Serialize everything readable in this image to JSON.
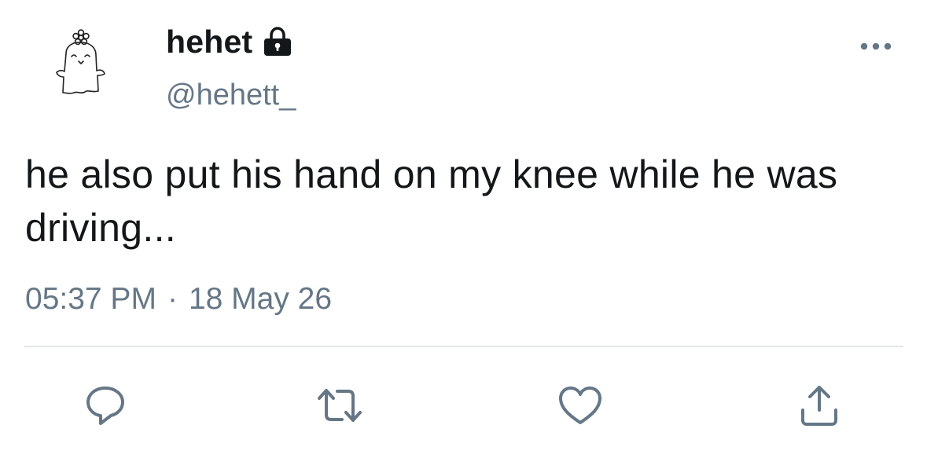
{
  "user": {
    "display_name": "hehet",
    "handle": "@hehett_",
    "protected": true
  },
  "tweet": {
    "text": "he also put his hand on my knee while he was driving...",
    "time": "05:37 PM",
    "separator": "·",
    "date": "18 May 26"
  },
  "actions": {
    "reply_icon": "reply-icon",
    "retweet_icon": "retweet-icon",
    "like_icon": "heart-icon",
    "share_icon": "share-icon",
    "more_icon": "more-icon"
  },
  "colors": {
    "text": "#14171a",
    "secondary": "#657786",
    "divider": "#e1e8ed"
  }
}
